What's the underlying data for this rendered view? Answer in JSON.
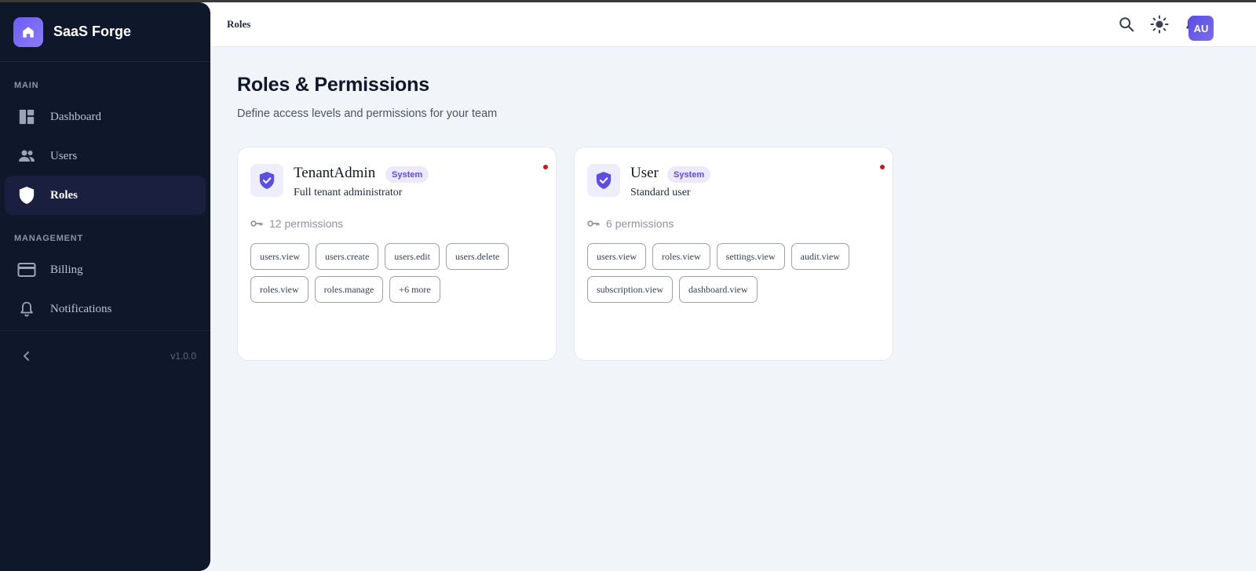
{
  "app": {
    "name": "SaaS Forge",
    "version": "v1.0.0"
  },
  "sidebar": {
    "sections": [
      {
        "label": "MAIN"
      },
      {
        "label": "MANAGEMENT"
      }
    ],
    "items": [
      {
        "label": "Dashboard",
        "icon": "dashboard-icon"
      },
      {
        "label": "Users",
        "icon": "users-icon"
      },
      {
        "label": "Roles",
        "icon": "shield-icon",
        "active": true
      },
      {
        "label": "Billing",
        "icon": "credit-card-icon"
      },
      {
        "label": "Notifications",
        "icon": "bell-icon"
      }
    ]
  },
  "header": {
    "breadcrumb": "Roles",
    "avatar_initials": "AU"
  },
  "page": {
    "title": "Roles & Permissions",
    "subtitle": "Define access levels and permissions for your team"
  },
  "roles": [
    {
      "name": "TenantAdmin",
      "badge": "System",
      "description": "Full tenant administrator",
      "permission_count": "12 permissions",
      "permissions": [
        "users.view",
        "users.create",
        "users.edit",
        "users.delete",
        "roles.view",
        "roles.manage",
        "+6 more"
      ]
    },
    {
      "name": "User",
      "badge": "System",
      "description": "Standard user",
      "permission_count": "6 permissions",
      "permissions": [
        "users.view",
        "roles.view",
        "settings.view",
        "audit.view",
        "subscription.view",
        "dashboard.view"
      ]
    }
  ],
  "colors": {
    "sidebar_bg": "#0f172a",
    "accent": "#6d5cf5",
    "badge_bg": "#ebe9fb",
    "badge_text": "#5b4bd6",
    "status_dot": "#c01b1b"
  }
}
